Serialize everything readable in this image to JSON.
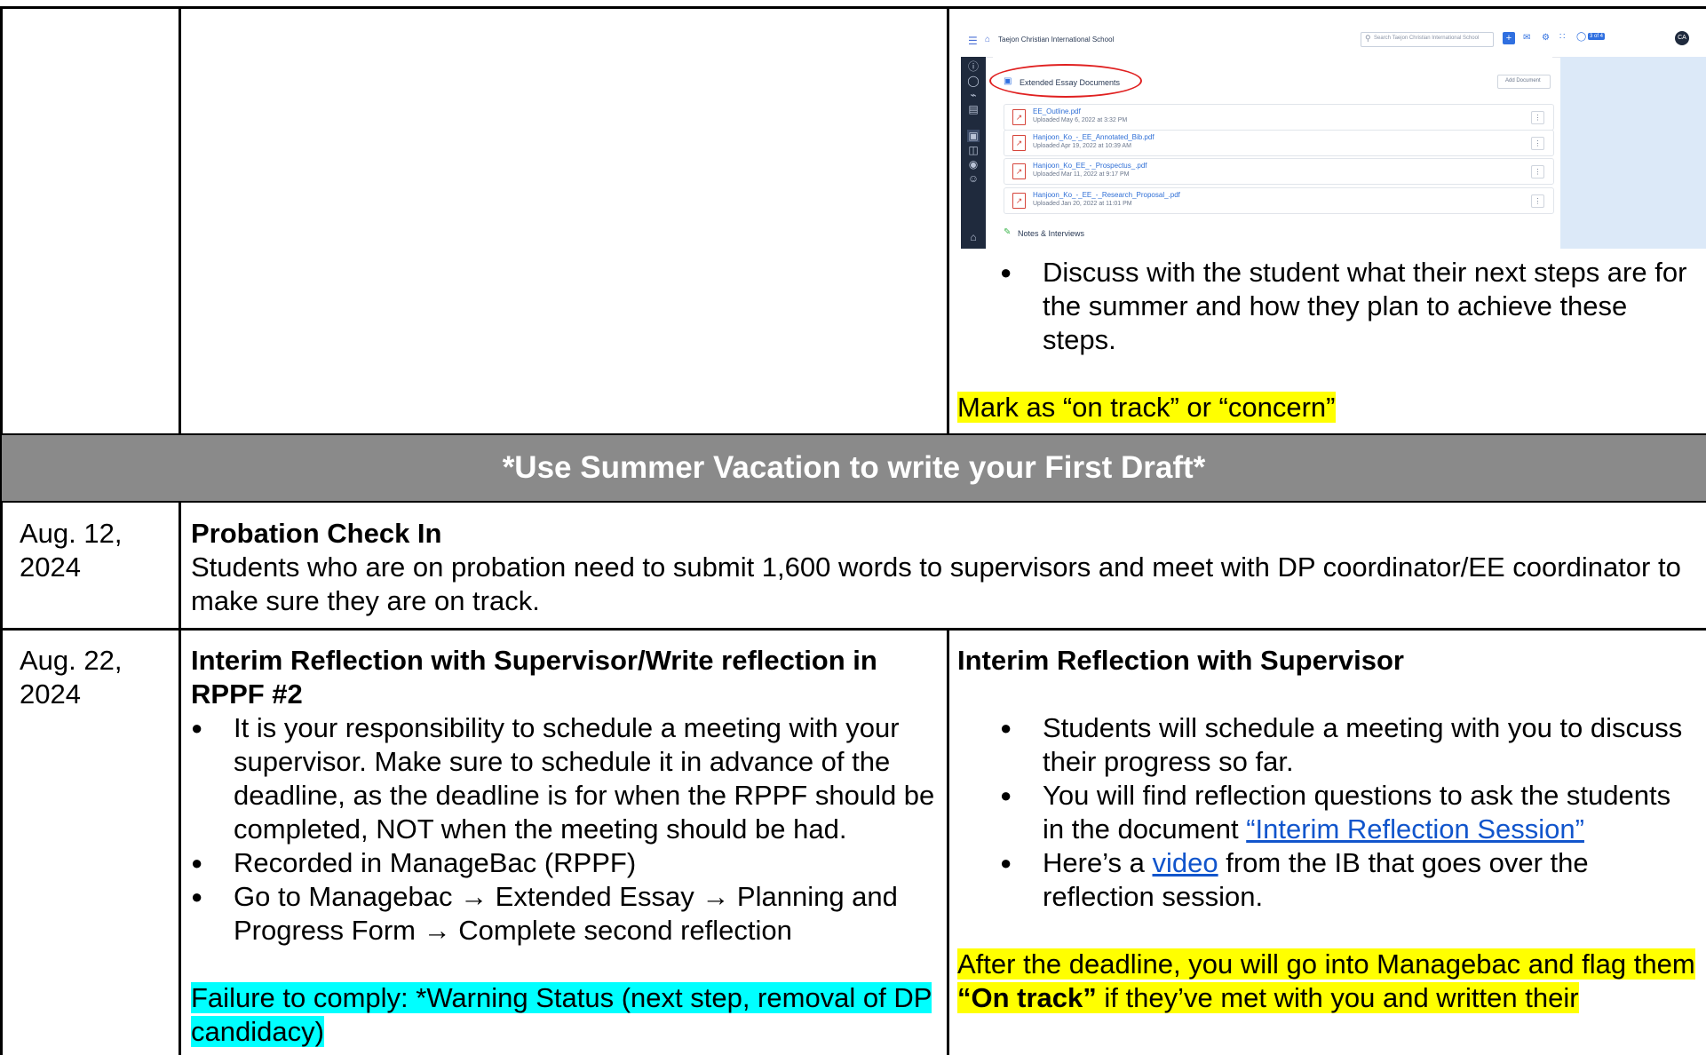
{
  "screenshot": {
    "school_name": "Taejon Christian International School",
    "search_placeholder": "Search Taejon Christian International School",
    "page_counter": "3 of 4",
    "avatar_initials": "CA",
    "section_title": "Extended Essay Documents",
    "add_document_label": "Add Document",
    "documents": [
      {
        "name": "EE_Outline.pdf",
        "uploaded": "Uploaded May 6, 2022 at 3:32 PM"
      },
      {
        "name": "Hanjoon_Ko_-_EE_Annotated_Bib.pdf",
        "uploaded": "Uploaded Apr 19, 2022 at 10:39 AM"
      },
      {
        "name": "Hanjoon_Ko_EE_-_Prospectus_.pdf",
        "uploaded": "Uploaded Mar 11, 2022 at 9:17 PM"
      },
      {
        "name": "Hanjoon_Ko_-_EE_-_Research_Proposal_.pdf",
        "uploaded": "Uploaded Jan 20, 2022 at 11:01 PM"
      }
    ],
    "notes_label": "Notes & Interviews"
  },
  "row1": {
    "bullet": "Discuss with the student what their next steps are for the summer and how they plan to achieve these steps.",
    "flag": "Mark as “on track” or “concern”"
  },
  "banner": "*Use Summer Vacation to write your First Draft*",
  "row2": {
    "date": "Aug. 12, 2024",
    "title": "Probation Check In",
    "body": "Students who are on probation need to submit 1,600 words to supervisors and meet with DP coordinator/EE coordinator to make sure they are on track."
  },
  "row3": {
    "date": "Aug. 22, 2024",
    "student_title": "Interim Reflection with Supervisor/Write reflection in RPPF #2",
    "student_bullets": [
      "It is your responsibility to schedule a meeting with your supervisor. Make sure to schedule it in advance of the deadline, as the deadline is for when the RPPF should be completed, NOT when the meeting should be had.",
      "Recorded in ManageBac (RPPF)",
      "Go to Managebac → Extended Essay → Planning and Progress Form → Complete second reflection"
    ],
    "student_warning": "Failure to comply: *Warning Status (next step, removal of DP candidacy)",
    "supervisor_title": "Interim Reflection with Supervisor",
    "supervisor_b1": "Students will schedule a meeting with you to discuss their progress so far.",
    "supervisor_b2_pre": "You will find reflection questions to ask the students in the document ",
    "supervisor_b2_link": "“Interim Reflection Session”",
    "supervisor_b3_pre": "Here’s a ",
    "supervisor_b3_link": "video",
    "supervisor_b3_post": " from the IB that goes over the reflection session.",
    "supervisor_flag_pre": "After the deadline, you will go into Managebac and flag them ",
    "supervisor_flag_bold": "“On track”",
    "supervisor_flag_post": " if they’ve met with you and written their"
  },
  "colors": {
    "highlight_yellow": "#ffff00",
    "highlight_cyan": "#00ffff",
    "banner_gray": "#8a8a8a",
    "link_blue": "#1155cc"
  }
}
